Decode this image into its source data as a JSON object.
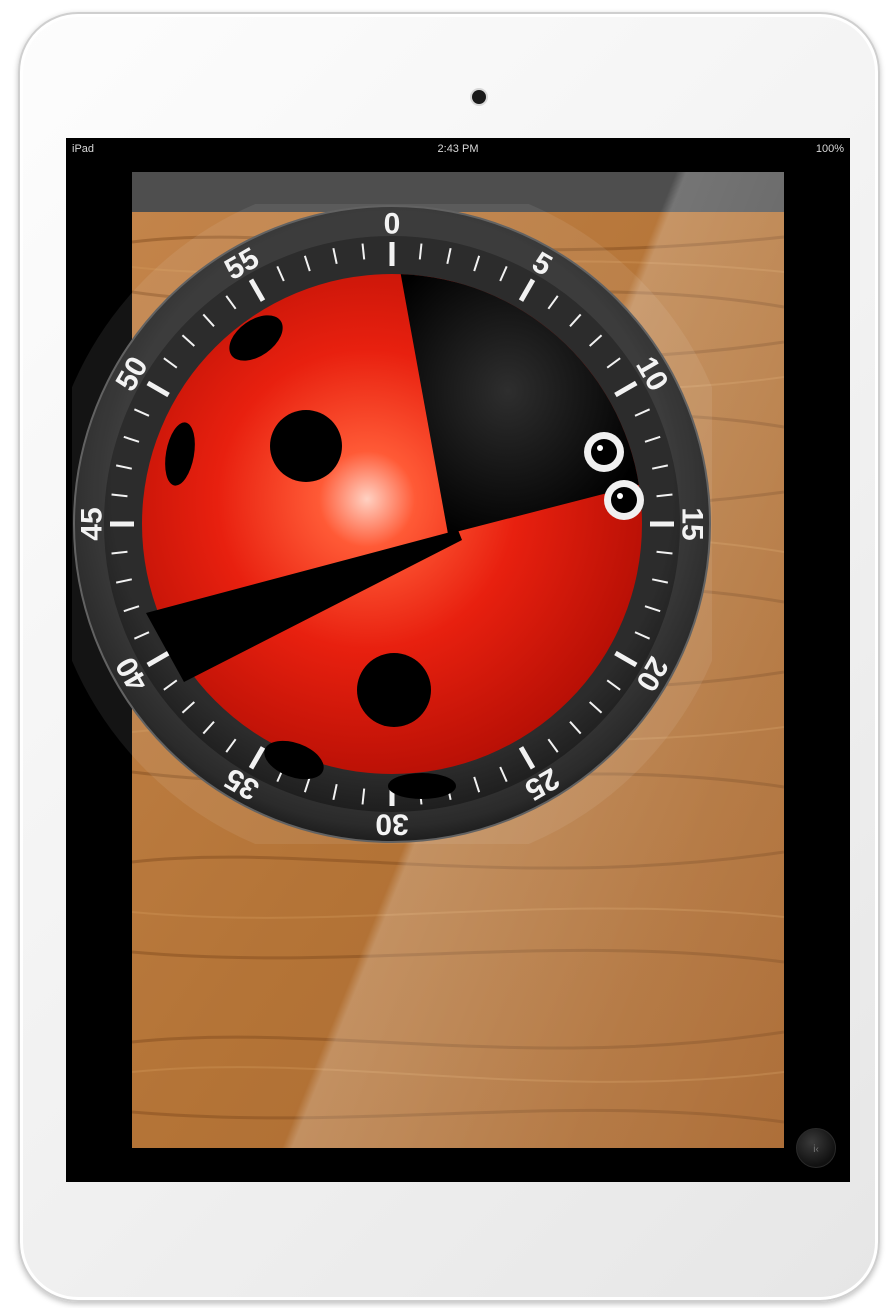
{
  "status_bar": {
    "left": "iPad",
    "time": "2:43 PM",
    "right": "100%"
  },
  "timer": {
    "dial_labels": [
      "0",
      "5",
      "10",
      "15",
      "20",
      "25",
      "30",
      "35",
      "40",
      "45",
      "50",
      "55"
    ],
    "set_minutes": 13.5,
    "colors": {
      "shell": "#e8200f",
      "remaining_segment": "#000000",
      "bezel": "#1e1e1e",
      "numbers": "#f2f2f2"
    }
  },
  "info_button": {
    "label": "i‹"
  },
  "icons": {
    "camera": "camera-icon",
    "home": "home-button-icon",
    "info": "info-icon"
  }
}
